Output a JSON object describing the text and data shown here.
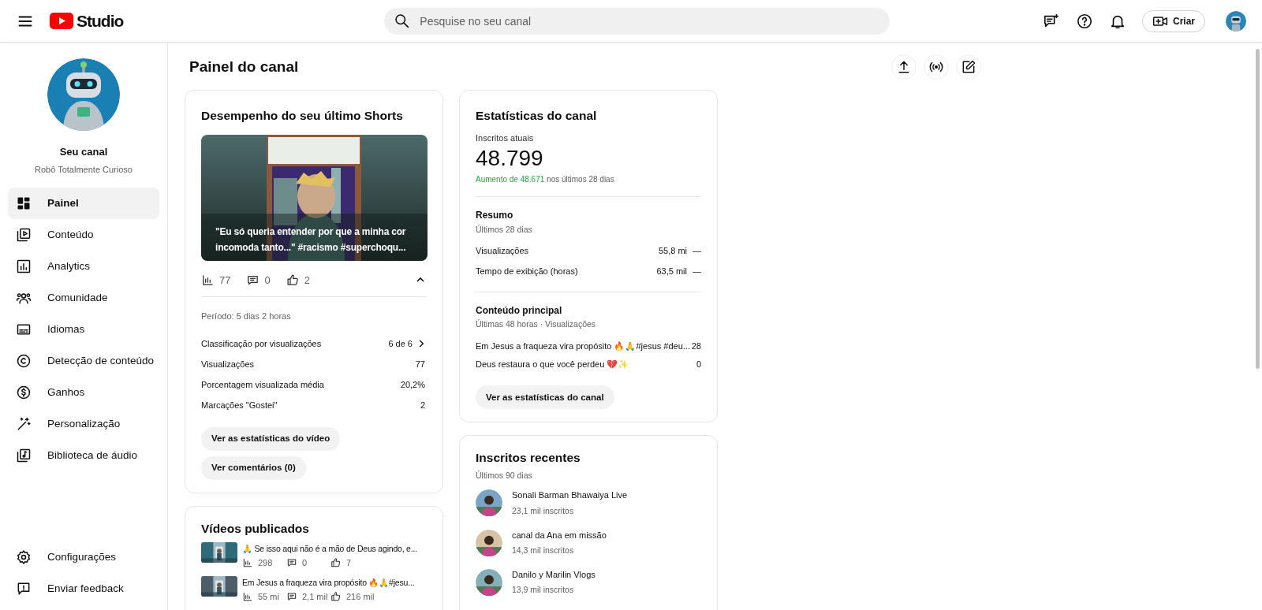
{
  "header": {
    "logo_text": "Studio",
    "search_placeholder": "Pesquise no seu canal",
    "create_label": "Criar"
  },
  "sidebar": {
    "channel_label": "Seu canal",
    "channel_name": "Robô Totalmente Curioso",
    "nav": [
      {
        "label": "Painel",
        "kind": "dashboard",
        "selected": true
      },
      {
        "label": "Conteúdo",
        "kind": "content",
        "selected": false
      },
      {
        "label": "Analytics",
        "kind": "analytics",
        "selected": false
      },
      {
        "label": "Comunidade",
        "kind": "community",
        "selected": false
      },
      {
        "label": "Idiomas",
        "kind": "subtitles",
        "selected": false
      },
      {
        "label": "Detecção de conteúdo",
        "kind": "copyright",
        "selected": false
      },
      {
        "label": "Ganhos",
        "kind": "earn",
        "selected": false
      },
      {
        "label": "Personalização",
        "kind": "magic",
        "selected": false
      },
      {
        "label": "Biblioteca de áudio",
        "kind": "audio",
        "selected": false
      }
    ],
    "footer": [
      {
        "label": "Configurações",
        "kind": "settings"
      },
      {
        "label": "Enviar feedback",
        "kind": "feedback"
      }
    ]
  },
  "page_title": "Painel do canal",
  "shorts_card": {
    "title": "Desempenho do seu último Shorts",
    "caption": "\"Eu só queria entender por que a minha cor incomoda tanto...\" #racismo #superchoqu...",
    "views": "77",
    "comments": "0",
    "likes": "2",
    "expanded": true,
    "period": "Período: 5 dias 2 horas",
    "rows": [
      {
        "label": "Classificação por visualizações",
        "value": "6 de 6",
        "kind": "link"
      },
      {
        "label": "Visualizações",
        "value": "77",
        "kind": "plain"
      },
      {
        "label": "Porcentagem visualizada média",
        "value": "20,2%",
        "kind": "plain"
      },
      {
        "label": "Marcações \"Gostei\"",
        "value": "2",
        "kind": "plain"
      }
    ],
    "buttons": [
      "Ver as estatísticas do vídeo",
      "Ver comentários (0)"
    ]
  },
  "published_videos": {
    "title": "Vídeos publicados",
    "items": [
      {
        "title": "🙏 Se isso aqui não é a mão de Deus agindo, e...",
        "views": "298",
        "comments": "0",
        "likes": "7"
      },
      {
        "title": "Em Jesus a fraqueza vira propósito 🔥🙏#jesu...",
        "views": "55 mi",
        "comments": "2,1 mil",
        "likes": "216 mil"
      }
    ]
  },
  "channel_stats": {
    "title": "Estatísticas do canal",
    "subscribers_label": "Inscritos atuais",
    "subscribers": "48.799",
    "growth": "Aumento de 48.671",
    "growth_rest": "nos últimos 28 dias",
    "summary_title": "Resumo",
    "summary_period": "Últimos 28 dias",
    "metrics": [
      {
        "label": "Visualizações",
        "value": "55,8 mi",
        "trend": "—"
      },
      {
        "label": "Tempo de exibição (horas)",
        "value": "63,5 mil",
        "trend": "—"
      }
    ],
    "top_title": "Conteúdo principal",
    "top_period": "Últimas 48 horas · Visualizações",
    "top_items": [
      {
        "title": "Em Jesus a fraqueza vira propósito 🔥🙏#jesus #deu...",
        "value": "28"
      },
      {
        "title": "Deus restaura o que você perdeu 💔✨",
        "value": "0"
      }
    ],
    "button": "Ver as estatísticas do canal"
  },
  "recent_subscribers": {
    "title": "Inscritos recentes",
    "period": "Últimos 90 dias",
    "items": [
      {
        "name": "Sonali Barman Bhawaiya Live",
        "subscribers": "23,1 mil inscritos"
      },
      {
        "name": "canal da Ana em missão",
        "subscribers": "14,3 mil inscritos"
      },
      {
        "name": "Danilo y Marilin Vlogs",
        "subscribers": "13,9 mil inscritos"
      }
    ]
  }
}
